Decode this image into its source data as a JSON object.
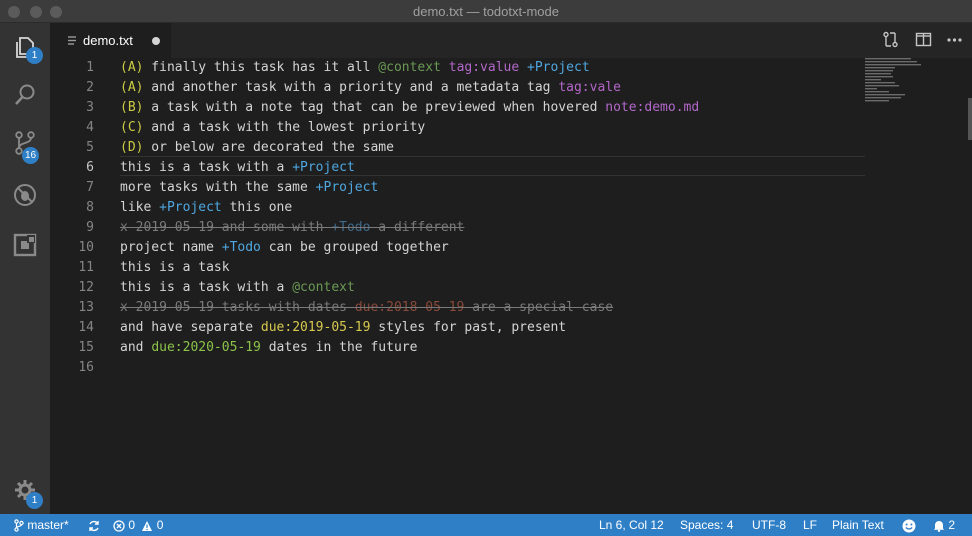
{
  "window": {
    "title": "demo.txt — todotxt-mode"
  },
  "activity_bar": {
    "explorer_badge": "1",
    "source_control_badge": "16",
    "settings_badge": "1"
  },
  "tab": {
    "label": "demo.txt"
  },
  "editor": {
    "line_numbers": [
      "1",
      "2",
      "3",
      "4",
      "5",
      "6",
      "7",
      "8",
      "9",
      "10",
      "11",
      "12",
      "13",
      "14",
      "15",
      "16"
    ],
    "active_line": "6",
    "lines": {
      "l1": {
        "prio": "(A)",
        "t1": " finally this task has it all ",
        "ctx": "@context",
        "t2": " ",
        "tag": "tag:value",
        "t3": " ",
        "proj": "+Project"
      },
      "l2": {
        "prio": "(A)",
        "t1": " and another task with a priority and a metadata tag ",
        "tag": "tag:vale"
      },
      "l3": {
        "prio": "(B)",
        "t1": " a task with a note tag that can be previewed when hovered ",
        "tag": "note:demo.md"
      },
      "l4": {
        "prio": "(C)",
        "t1": " and a task with the lowest priority"
      },
      "l5": {
        "prio": "(D)",
        "t1": " or below are decorated the same"
      },
      "l6": {
        "t1": "this is a task with a ",
        "proj": "+Project"
      },
      "l7": {
        "t1": "more tasks with the same ",
        "proj": "+Project"
      },
      "l8": {
        "t1": "like ",
        "proj": "+Project",
        "t2": " this one"
      },
      "l9": {
        "t1": "x 2019-05-19 and some with ",
        "proj": "+Todo",
        "t2": " a different"
      },
      "l10": {
        "t1": "project name ",
        "proj": "+Todo",
        "t2": " can be grouped together"
      },
      "l11": {
        "t1": "this is a task"
      },
      "l12": {
        "t1": "this is a task with a ",
        "ctx": "@context"
      },
      "l13": {
        "t1": "x 2019-05-19 tasks with dates ",
        "due": "due:2018-05-19",
        "t2": " are a special case"
      },
      "l14": {
        "t1": "and have separate ",
        "due": "due:2019-05-19",
        "t2": " styles for past, present"
      },
      "l15": {
        "t1": "and ",
        "due": "due:2020-05-19",
        "t2": " dates in the future"
      },
      "l16": {
        "t1": ""
      }
    }
  },
  "status_bar": {
    "branch": "master*",
    "errors": "0",
    "warnings": "0",
    "position": "Ln 6, Col 12",
    "indent": "Spaces: 4",
    "encoding": "UTF-8",
    "eol": "LF",
    "language": "Plain Text",
    "notifications": "2"
  },
  "colors": {
    "status_bar": "#2f7fc7",
    "priority": "#cccc44",
    "context": "#6a9955",
    "tag": "#b267c8",
    "project": "#4fa7e0",
    "due_present": "#d7c94e",
    "due_future": "#8bc34a"
  }
}
